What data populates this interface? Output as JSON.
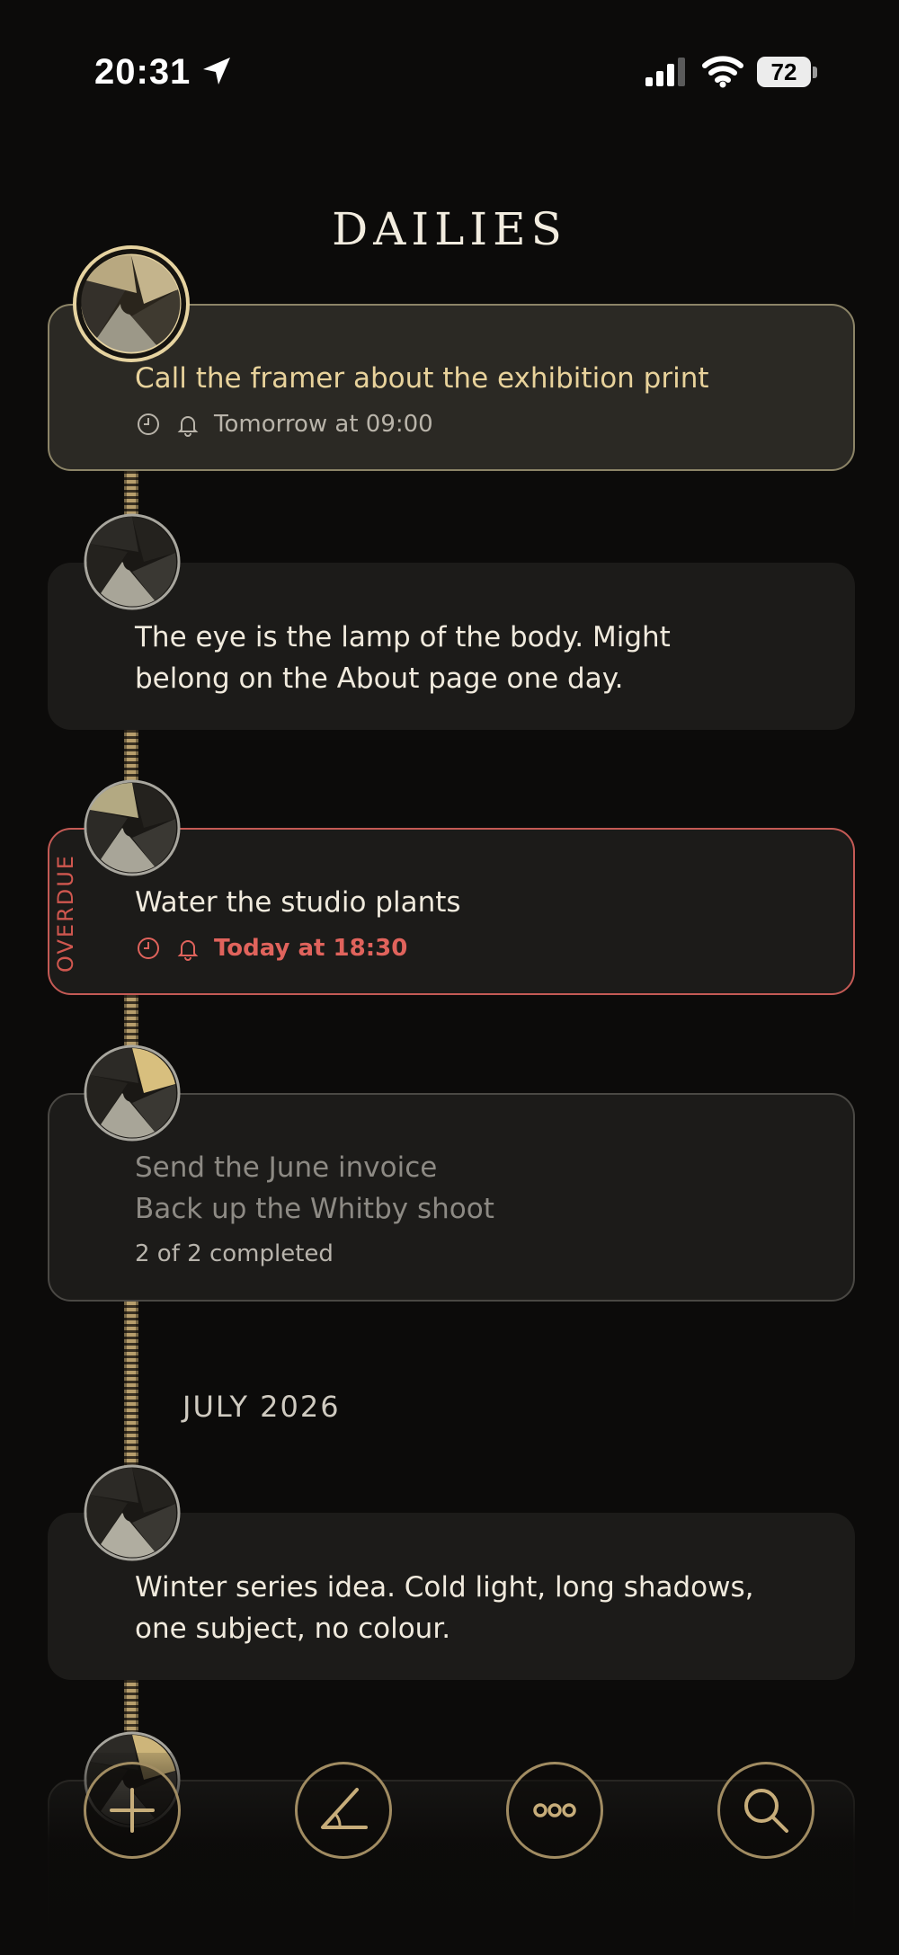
{
  "status_bar": {
    "time": "20:31",
    "battery": "72"
  },
  "header": {
    "title": "DAILIES"
  },
  "entries": [
    {
      "text": "Call the framer about the exhibition print",
      "reminder": "Tomorrow at 09:00"
    },
    {
      "lines": [
        "The eye is the lamp of the body. Might",
        "belong on the About page one day."
      ]
    },
    {
      "text": "Water the studio plants",
      "status": "OVERDUE",
      "reminder": "Today at 18:30"
    },
    {
      "lines": [
        "Send the June invoice",
        "Back up the Whitby shoot"
      ],
      "count": "2 of 2 completed"
    },
    {
      "lines": [
        "Winter series idea. Cold light, long shadows,",
        "one subject, no colour."
      ]
    }
  ],
  "sections": {
    "month": "JULY 2026"
  },
  "bottom_nav": {
    "icons": [
      "plus-icon",
      "angle-icon",
      "more-icon",
      "search-icon"
    ]
  },
  "colors": {
    "accent_gold": "#e8d29b",
    "overdue_red": "#e0635c",
    "background": "#0c0b0a"
  }
}
